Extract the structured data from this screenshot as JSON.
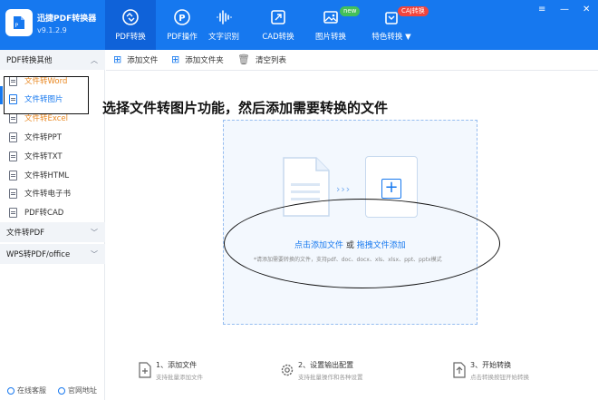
{
  "app": {
    "title": "迅捷PDF转换器",
    "version": "v9.1.2.9"
  },
  "nav": {
    "tabs": [
      {
        "label": "PDF转换",
        "active": true
      },
      {
        "label": "PDF操作"
      },
      {
        "label": "文字识别"
      },
      {
        "label": "CAD转换"
      },
      {
        "label": "图片转换",
        "badge": "new"
      },
      {
        "label": "特色转换 ▼",
        "badge": "CAJ转换"
      }
    ]
  },
  "window": {
    "menu": "≡",
    "minimize": "—",
    "close": "✕"
  },
  "sidebar": {
    "section1": "PDF转换其他",
    "items": [
      {
        "label": "文件转Word",
        "style": "orange"
      },
      {
        "label": "文件转图片",
        "style": "selected"
      },
      {
        "label": "文件转Excel",
        "style": "orange"
      },
      {
        "label": "文件转PPT"
      },
      {
        "label": "文件转TXT"
      },
      {
        "label": "文件转HTML"
      },
      {
        "label": "文件转电子书"
      },
      {
        "label": "PDF转CAD"
      }
    ],
    "section2": "文件转PDF",
    "section3": "WPS转PDF/office",
    "footer": {
      "support": "在线客服",
      "website": "官网地址"
    }
  },
  "toolbar": {
    "add_file": "添加文件",
    "add_folder": "添加文件夹",
    "clear": "清空列表"
  },
  "annotation": {
    "title": "选择文件转图片功能，然后添加需要转换的文件"
  },
  "dropzone": {
    "click_add": "点击添加文件",
    "or": "或",
    "drag_add": "拖拽文件添加",
    "hint": "*请添加需要转换的文件，支持pdf、doc、docx、xls、xlsx、ppt、pptx模式"
  },
  "steps": [
    {
      "title": "1、添加文件",
      "desc": "支持批量添加文件"
    },
    {
      "title": "2、设置输出配置",
      "desc": "支持批量操作和各种设置"
    },
    {
      "title": "3、开始转换",
      "desc": "点击转换按钮开始转换"
    }
  ],
  "colors": {
    "brand": "#1678ef",
    "active_tab": "#0f62d9",
    "highlight": "#e98822"
  }
}
